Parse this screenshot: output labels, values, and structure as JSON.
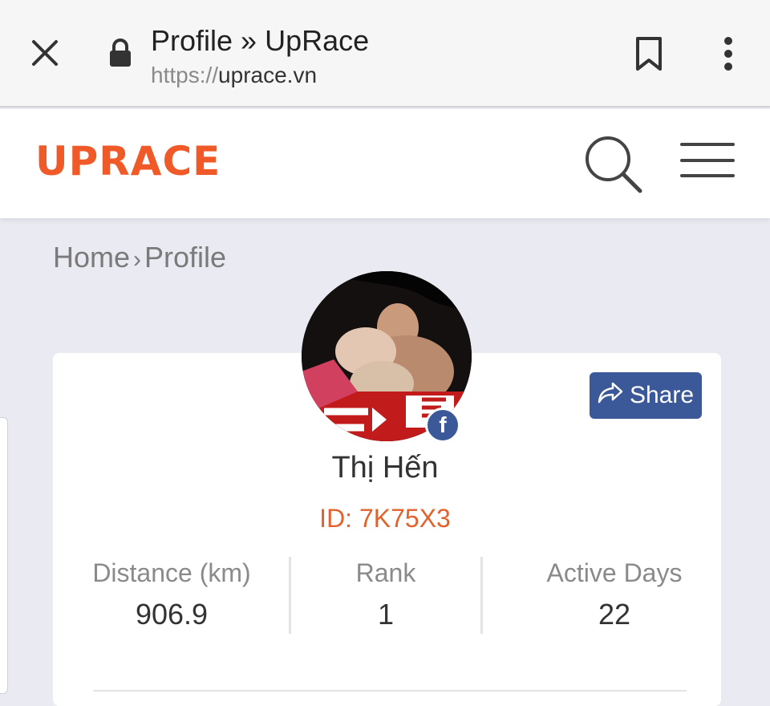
{
  "browser": {
    "page_title": "Profile » UpRace",
    "url_scheme": "https://",
    "url_host": "uprace.vn"
  },
  "site": {
    "logo_text": "UPRACE",
    "brand_color": "#f05a28"
  },
  "breadcrumb": {
    "home": "Home",
    "separator": "›",
    "current": "Profile"
  },
  "profile": {
    "name": "Thị Hến",
    "id_label": "ID: 7K75X3",
    "share_label": "Share",
    "social_badge": "f",
    "stats": [
      {
        "label": "Distance (km)",
        "value": "906.9"
      },
      {
        "label": "Rank",
        "value": "1"
      },
      {
        "label": "Active Days",
        "value": "22"
      }
    ]
  },
  "icons": [
    "close-icon",
    "lock-icon",
    "bookmark-icon",
    "more-vertical-icon",
    "search-icon",
    "hamburger-menu-icon",
    "share-arrow-icon",
    "facebook-icon"
  ]
}
